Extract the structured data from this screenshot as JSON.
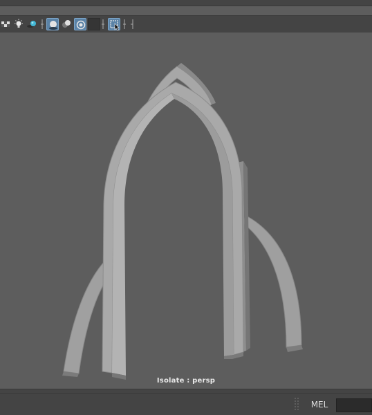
{
  "viewport": {
    "hud_label": "Isolate : persp"
  },
  "command_line": {
    "language": "MEL",
    "input_value": ""
  },
  "toolbar": {
    "icons": [
      "checker-icon",
      "light-bulb-icon",
      "shadow-light-icon",
      "separator",
      "ambient-occlusion-icon",
      "motion-blur-icon",
      "anti-aliasing-icon",
      "depth-of-field-icon",
      "separator",
      "isolate-select-icon",
      "xray-icon"
    ]
  },
  "colors": {
    "viewport_bg": "#5d5d5d",
    "panel_bg": "#444444",
    "accent": "#5a82a6",
    "model_light": "#a7a7a7",
    "model_dark": "#7a7a7a"
  }
}
